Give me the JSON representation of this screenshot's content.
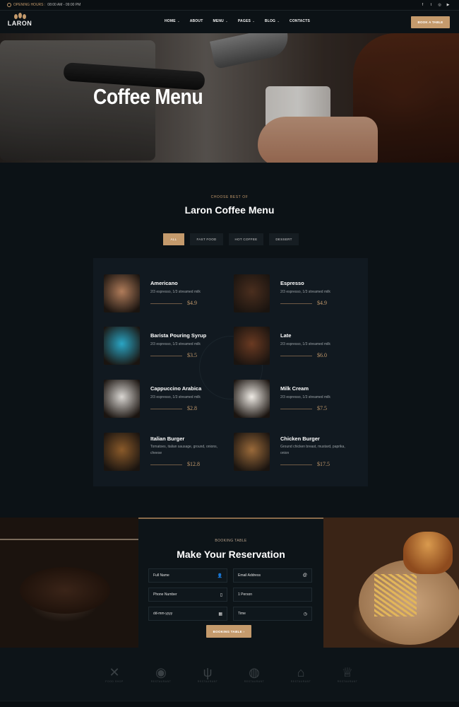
{
  "topbar": {
    "hours_label": "OPENING HOURS :",
    "hours_value": "08:00 AM - 09:00 PM",
    "socials": [
      "f",
      "t",
      "◎",
      "▶"
    ]
  },
  "nav": {
    "logo_text": "LARON",
    "items": [
      {
        "label": "HOME",
        "dropdown": true
      },
      {
        "label": "ABOUT",
        "dropdown": false
      },
      {
        "label": "MENU",
        "dropdown": true
      },
      {
        "label": "PAGES",
        "dropdown": true
      },
      {
        "label": "BLOG",
        "dropdown": true
      },
      {
        "label": "CONTACTS",
        "dropdown": false
      }
    ],
    "book_button": "BOOK A TABLE"
  },
  "hero": {
    "title": "Coffee Menu"
  },
  "menu_section": {
    "subtitle": "CHOOSE BEST OF",
    "title": "Laron Coffee Menu",
    "filters": [
      "ALL",
      "FAST FOOD",
      "HOT COFFEE",
      "DESSERT"
    ],
    "active_filter": "ALL",
    "dishes": [
      {
        "name": "Americano",
        "desc": "2/3 espresso, 1/3 streamed milk",
        "price": "$4.9",
        "img_color": "#b07c5a"
      },
      {
        "name": "Espresso",
        "desc": "2/3 espresso, 1/3 streamed milk",
        "price": "$4.9",
        "img_color": "#4a2e1e"
      },
      {
        "name": "Barista Pouring Syrup",
        "desc": "2/3 espresso, 1/3 streamed milk",
        "price": "$3.5",
        "img_color": "#2aa5c4"
      },
      {
        "name": "Late",
        "desc": "2/3 espresso, 1/3 streamed milk",
        "price": "$6.0",
        "img_color": "#6a3a22"
      },
      {
        "name": "Cappuccino Arabica",
        "desc": "2/3 espresso, 1/3 streamed milk",
        "price": "$2.8",
        "img_color": "#d9d6d2"
      },
      {
        "name": "Milk Cream",
        "desc": "2/3 espresso, 1/3 streamed milk",
        "price": "$7.5",
        "img_color": "#eeeae4"
      },
      {
        "name": "Italian Burger",
        "desc": "Tomatoes, italian sausage, ground, onions, cheese",
        "price": "$12.8",
        "img_color": "#8a5a2a"
      },
      {
        "name": "Chicken Burger",
        "desc": "Ground chicken breast, mustard, paprika, onion",
        "price": "$17.5",
        "img_color": "#9a6a3a"
      }
    ]
  },
  "reservation": {
    "subtitle": "BOOKING TABLE",
    "title": "Make Your Reservation",
    "fields": [
      {
        "placeholder": "Full Name",
        "icon": "user-icon",
        "glyph": "👤"
      },
      {
        "placeholder": "Email Address",
        "icon": "at-icon",
        "glyph": "@"
      },
      {
        "placeholder": "Phone Number",
        "icon": "phone-icon",
        "glyph": "▯"
      },
      {
        "placeholder": "1 Person",
        "icon": "",
        "glyph": ""
      },
      {
        "placeholder": "dd-mm-yyyy",
        "icon": "calendar-icon",
        "glyph": "▦"
      },
      {
        "placeholder": "Time",
        "icon": "clock-icon",
        "glyph": "◷"
      }
    ],
    "button": "BOOKING TABLE ›"
  },
  "brand_logos": [
    {
      "mark": "✕",
      "label": "FOOD SHOP",
      "icon": "crossed-utensils-logo"
    },
    {
      "mark": "◉",
      "label": "RESTAURANT",
      "icon": "round-restaurant-logo"
    },
    {
      "mark": "ψ",
      "label": "RESTAURANT",
      "icon": "cutlery-restaurant-logo"
    },
    {
      "mark": "◍",
      "label": "RESTAURANT",
      "icon": "plate-restaurant-logo"
    },
    {
      "mark": "⌂",
      "label": "RESTAURANT",
      "icon": "cloche-restaurant-logo"
    },
    {
      "mark": "♕",
      "label": "RESTAURANT",
      "icon": "chef-hat-restaurant-logo"
    }
  ]
}
